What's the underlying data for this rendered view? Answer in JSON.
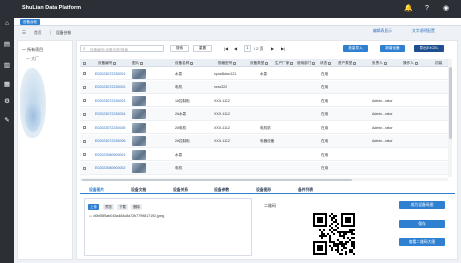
{
  "app": {
    "title": "ShuLian Data Platform"
  },
  "header": {
    "icons": [
      "bell-icon",
      "help-icon",
      "user-icon"
    ],
    "glyphs": [
      "🔔",
      "?",
      "◉"
    ]
  },
  "tabstrip": {
    "active_tab": "设备台帐"
  },
  "leftnav": {
    "glyphs": [
      "⌂",
      "▤",
      "▥",
      "▦",
      "⚙",
      "✎"
    ]
  },
  "breadcrumb": {
    "home": "首页",
    "current": "设备台帐"
  },
  "top_links": {
    "link1": "编辑表显示",
    "link2": "文字说明配置"
  },
  "tree": {
    "root": "一 所有项目",
    "child": "一 大厂"
  },
  "search": {
    "placeholder": "设备编号/设备名称/规格"
  },
  "toolbar": {
    "search_btn": "搜索",
    "reset_btn": "重置",
    "first": "|◀",
    "prev": "◀",
    "page": "1",
    "total": "/ 2 页",
    "next": "▶",
    "last": "▶|",
    "import_btn": "批量导入",
    "add_btn": "新增设备",
    "export_btn": "导出EXCEL"
  },
  "table": {
    "headers": [
      "设备编号",
      "图片",
      "设备名称",
      "规格型号",
      "设备类型",
      "生产厂家",
      "使用部门",
      "状态",
      "资产类型",
      "负责人",
      "操作人",
      "初装"
    ],
    "rows": [
      {
        "code": "E02023072230001",
        "name": "水泵",
        "spec": "cpuxl6don121",
        "type": "水泵",
        "dept": "",
        "status": "在用",
        "owner": ""
      },
      {
        "code": "E02023072230002",
        "name": "电机",
        "spec": "xxxx222",
        "type": "",
        "dept": "",
        "status": "在用",
        "owner": ""
      },
      {
        "code": "E02023072230003",
        "name": "1#控制柜",
        "spec": "XXX-1112",
        "type": "",
        "dept": "",
        "status": "在用",
        "owner": "Admin...rator"
      },
      {
        "code": "E02023072230004",
        "name": "2#水泵",
        "spec": "XXX-1112",
        "type": "",
        "dept": "",
        "status": "在用",
        "owner": "Admin...rator"
      },
      {
        "code": "E02023072230005",
        "name": "2#电机",
        "spec": "XXX-1112",
        "type": "电机机",
        "dept": "",
        "status": "在用",
        "owner": "Admin...rator"
      },
      {
        "code": "E02023072230006",
        "name": "2#控制柜",
        "spec": "XXX-1112",
        "type": "电器设备",
        "dept": "",
        "status": "在用",
        "owner": "Admin...rator"
      },
      {
        "code": "E02023080900001",
        "name": "水泵",
        "spec": "",
        "type": "",
        "dept": "",
        "status": "在用",
        "owner": ""
      },
      {
        "code": "E02023080900002",
        "name": "电机",
        "spec": "",
        "type": "",
        "dept": "",
        "status": "在用",
        "owner": ""
      }
    ]
  },
  "subtabs": [
    "设备图片",
    "设备文档",
    "设备关系",
    "设备参数",
    "设备图形",
    "备件列表"
  ],
  "detail": {
    "upload_btn": "上传",
    "preview_btn": "预览",
    "download_btn": "下载",
    "delete_btn": "删除",
    "file_name": "d0b55f5ab015a484c8a72b7799817192.jpeg",
    "qr_label": "二维码",
    "generate_btn": "成为设备母图",
    "save_btn": "保存",
    "view_qr_btn": "查看二维码大图"
  }
}
